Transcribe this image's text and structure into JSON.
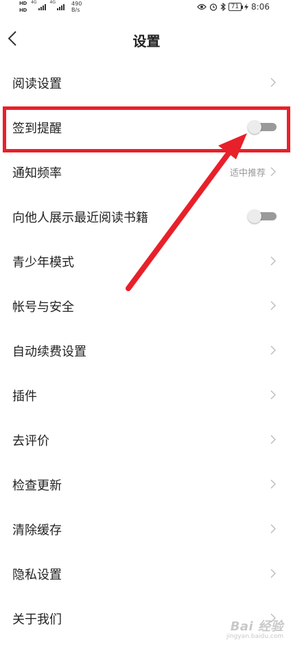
{
  "status_bar": {
    "sim1": "HD",
    "sim2": "HD",
    "net1": "4G",
    "net2": "4G",
    "speed_value": "490",
    "speed_unit": "B/s",
    "battery": "71",
    "time": "8:06"
  },
  "header": {
    "title": "设置"
  },
  "settings": {
    "reading": "阅读设置",
    "checkin_reminder": "签到提醒",
    "notify_freq": "通知频率",
    "notify_freq_value": "适中推荐",
    "show_recent": "向他人展示最近阅读书籍",
    "teen_mode": "青少年模式",
    "account_security": "帐号与安全",
    "auto_renew": "自动续费设置",
    "plugins": "插件",
    "rate": "去评价",
    "check_update": "检查更新",
    "clear_cache": "清除缓存",
    "privacy": "隐私设置",
    "about": "关于我们"
  },
  "toggles": {
    "checkin_reminder_on": false,
    "show_recent_on": false
  },
  "watermark": {
    "main": "Bai 经验",
    "sub": "jingyan.baidu.com"
  },
  "colors": {
    "annotation_red": "#e8202a",
    "toggle_track": "#9a9a9a",
    "secondary_text": "#999999"
  }
}
